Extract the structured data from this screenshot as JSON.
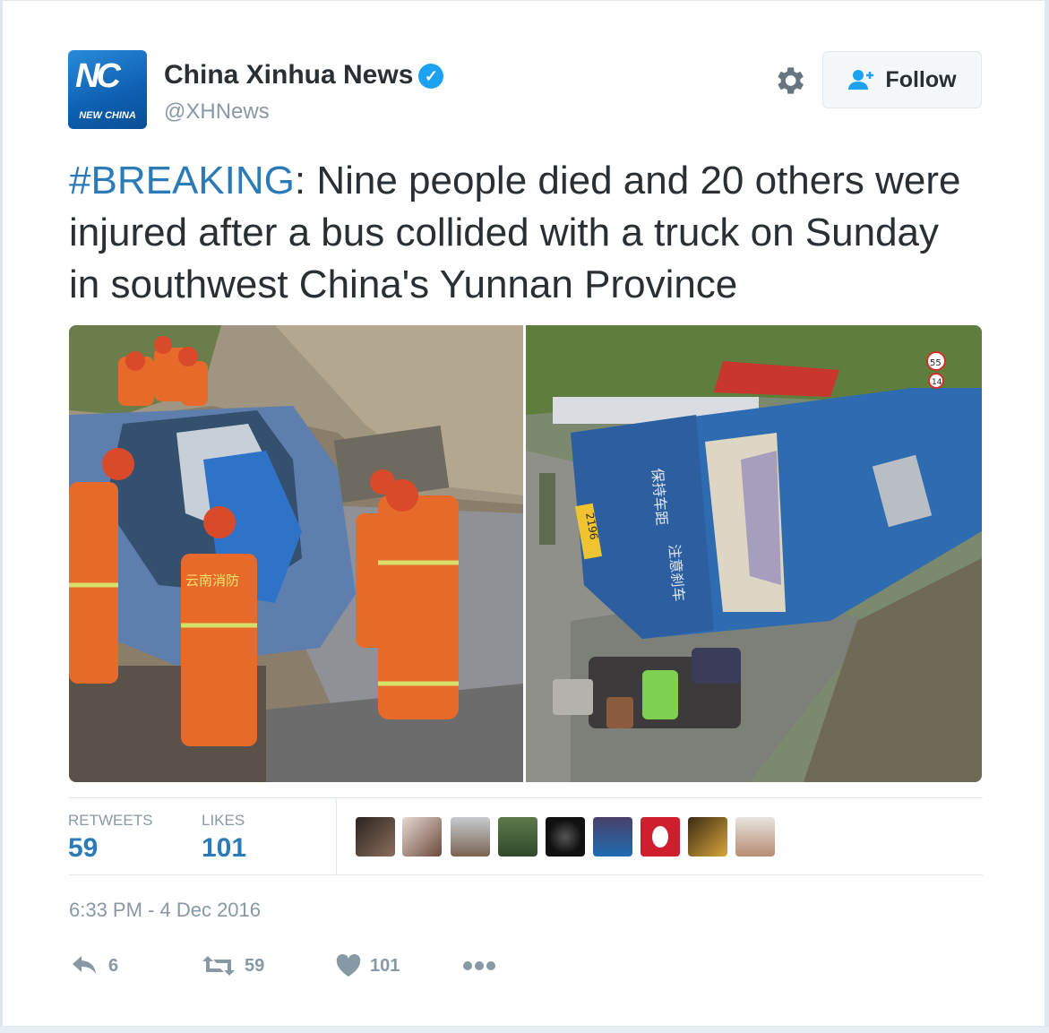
{
  "account": {
    "name": "China Xinhua News",
    "handle": "@XHNews",
    "avatar_text": "NC",
    "avatar_tagline": "NEW CHINA"
  },
  "actions_top": {
    "follow_label": "Follow"
  },
  "tweet": {
    "hashtag": "#BREAKING",
    "text": ": Nine people died and 20 others were injured after a bus collided with a truck on Sunday in southwest China's Yunnan Province"
  },
  "media": {
    "left_sign_text": "云南消防",
    "bus_plate": "2196",
    "bus_side_text_1": "保持车距",
    "bus_side_text_2": "注意刹车",
    "road_sign_1": "55",
    "road_sign_2": "14"
  },
  "stats": {
    "retweets_label": "RETWEETS",
    "retweets_value": "59",
    "likes_label": "LIKES",
    "likes_value": "101"
  },
  "timestamp": "6:33 PM - 4 Dec 2016",
  "action_bar": {
    "reply_count": "6",
    "retweet_count": "59",
    "like_count": "101"
  },
  "colors": {
    "link_blue": "#2b7bb9",
    "verified_blue": "#1da1f2",
    "muted_gray": "#8899a6",
    "text_dark": "#292f33"
  },
  "icons": [
    "verified-icon",
    "gear-icon",
    "follow-user-icon",
    "reply-icon",
    "retweet-icon",
    "heart-icon",
    "more-icon"
  ]
}
